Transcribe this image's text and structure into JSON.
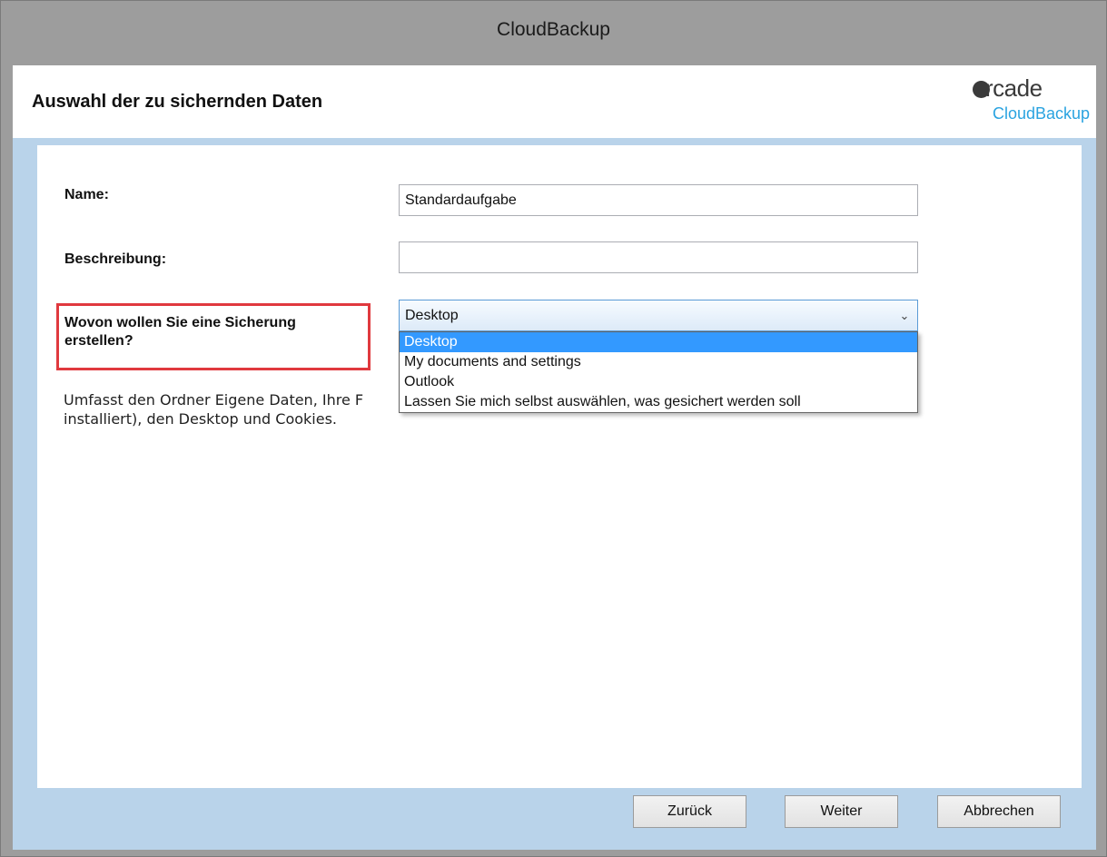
{
  "window": {
    "title": "CloudBackup"
  },
  "header": {
    "title": "Auswahl der zu sichernden Daten",
    "logo": {
      "word": "rcade",
      "sub": "CloudBackup"
    }
  },
  "form": {
    "name_label": "Name:",
    "name_value": "Standardaufgabe",
    "description_label": "Beschreibung:",
    "description_value": "",
    "source_label": "Wovon wollen Sie eine Sicherung erstellen?",
    "source_selected": "Desktop",
    "source_options": [
      "Desktop",
      "My documents and settings",
      "Outlook",
      "Lassen Sie mich selbst auswählen, was gesichert werden soll"
    ],
    "description_text": "Umfasst den Ordner Eigene Daten, Ihre F installiert), den Desktop und Cookies."
  },
  "buttons": {
    "back": "Zurück",
    "next": "Weiter",
    "cancel": "Abbrechen"
  },
  "colors": {
    "highlight": "#e0393e",
    "selection": "#3399ff",
    "frame": "#b9d3ea",
    "logo_accent": "#2aa3e0"
  }
}
